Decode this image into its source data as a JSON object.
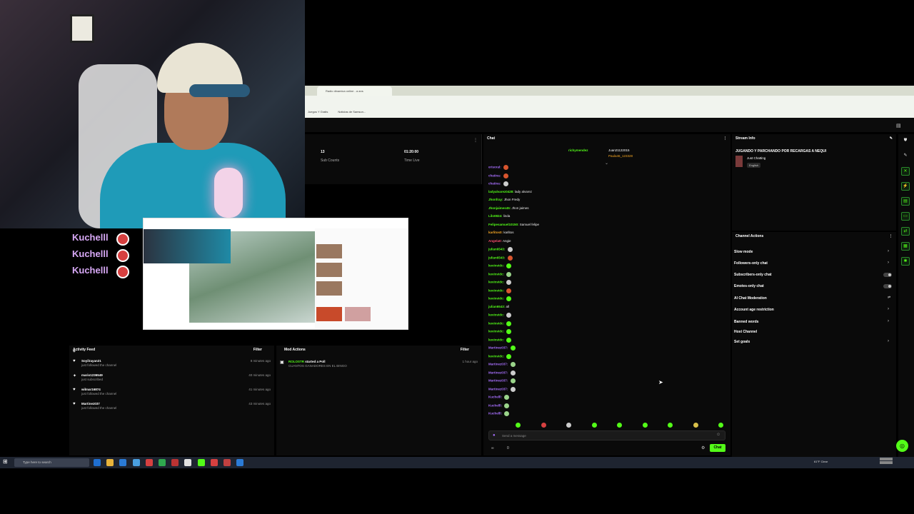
{
  "browser": {
    "tab_title": "Radio dinamica online - a ans",
    "bookmarks": [
      "Juegos Y Gratis",
      "Noticias de Samsun..."
    ]
  },
  "stats": [
    {
      "value": "13",
      "label": "Sub Counts"
    },
    {
      "value": "01:20:00",
      "label": "Time Live"
    }
  ],
  "overlay": {
    "names": [
      "Kuchelll",
      "Kuchelll",
      "Kuchelll"
    ]
  },
  "activity_feed": {
    "title": "Activity Feed",
    "filter_label": "Filter",
    "items": [
      {
        "user": "Soyilrayan21",
        "action": "just followed the channel",
        "time": "8 minutes ago",
        "icon": "heart-icon"
      },
      {
        "user": "mario1236549",
        "action": "just subscribed",
        "time": "40 minutes ago",
        "icon": "star-icon"
      },
      {
        "user": "wilmar16874",
        "action": "just followed the channel",
        "time": "41 minutes ago",
        "icon": "heart-icon"
      },
      {
        "user": "Martinez037",
        "action": "just followed the channel",
        "time": "43 minutes ago",
        "icon": "heart-icon"
      }
    ]
  },
  "mod_actions": {
    "title": "Mod Actions",
    "filter_label": "Filter",
    "items": [
      {
        "user": "ROLOSTR",
        "action": "started a Poll",
        "detail": "CUANTOS GANADORES EN EL BINGO",
        "time": "1 hour ago"
      }
    ]
  },
  "chat": {
    "title": "Chat",
    "pinned": [
      "richymendez",
      "Juan21122015",
      "Paula46_123328"
    ],
    "messages": [
      {
        "user": "erisoral:",
        "text": "",
        "color": "#a970ff",
        "emote": "#d8552e"
      },
      {
        "user": "chatina:",
        "text": "",
        "color": "#a970ff",
        "emote": "#d8552e"
      },
      {
        "user": "chatina:",
        "text": "",
        "color": "#a970ff",
        "emote": "#cccccc"
      },
      {
        "user": "ladyalvarez0428:",
        "text": "lady alvarez",
        "color": "#53fc18",
        "emote": ""
      },
      {
        "user": "Jhonfray:",
        "text": "Jhon Fredy",
        "color": "#53fc18",
        "emote": ""
      },
      {
        "user": "Jhonjaimes45:",
        "text": "Jhon jaimes",
        "color": "#53fc18",
        "emote": ""
      },
      {
        "user": "Lilo0824:",
        "text": "linda",
        "color": "#53fc18",
        "emote": ""
      },
      {
        "user": "Felipesamuel10150:",
        "text": "Samuel felipe",
        "color": "#53fc18",
        "emote": ""
      },
      {
        "user": "karlitos0:",
        "text": "karlitos",
        "color": "#f5a623",
        "emote": ""
      },
      {
        "user": "Angela0:",
        "text": "Angie",
        "color": "#ff4d6d",
        "emote": ""
      },
      {
        "user": "julian6543:",
        "text": "",
        "color": "#53fc18",
        "emote": "#cccccc"
      },
      {
        "user": "julian6543:",
        "text": "",
        "color": "#53fc18",
        "emote": "#d8552e"
      },
      {
        "user": "kevinvidc:",
        "text": "",
        "color": "#53fc18",
        "emote": "#53fc18"
      },
      {
        "user": "kevinvidc:",
        "text": "",
        "color": "#53fc18",
        "emote": "#9ad48a"
      },
      {
        "user": "kevinvidc:",
        "text": "",
        "color": "#53fc18",
        "emote": "#cccccc"
      },
      {
        "user": "kevinvidc:",
        "text": "",
        "color": "#53fc18",
        "emote": "#d8552e"
      },
      {
        "user": "kevinvidc:",
        "text": "",
        "color": "#53fc18",
        "emote": "#53fc18"
      },
      {
        "user": "julian6543:",
        "text": "all",
        "color": "#53fc18",
        "emote": ""
      },
      {
        "user": "kevinvidc:",
        "text": "",
        "color": "#53fc18",
        "emote": "#cccccc"
      },
      {
        "user": "kevinvidc:",
        "text": "",
        "color": "#53fc18",
        "emote": "#53fc18"
      },
      {
        "user": "kevinvidc:",
        "text": "",
        "color": "#53fc18",
        "emote": "#53fc18"
      },
      {
        "user": "kevinvidc:",
        "text": "",
        "color": "#53fc18",
        "emote": "#53fc18"
      },
      {
        "user": "Martinez037:",
        "text": "",
        "color": "#a970ff",
        "emote": "#53fc18"
      },
      {
        "user": "kevinvidc:",
        "text": "",
        "color": "#53fc18",
        "emote": "#53fc18"
      },
      {
        "user": "Martinez037:",
        "text": "",
        "color": "#a970ff",
        "emote": "#9ad48a"
      },
      {
        "user": "Martinez037:",
        "text": "",
        "color": "#a970ff",
        "emote": "#cccccc"
      },
      {
        "user": "Martinez037:",
        "text": "",
        "color": "#a970ff",
        "emote": "#9ad48a"
      },
      {
        "user": "Martinez037:",
        "text": "",
        "color": "#a970ff",
        "emote": "#cccccc"
      },
      {
        "user": "Kuchelll:",
        "text": "",
        "color": "#a970ff",
        "emote": "#9ad48a"
      },
      {
        "user": "Kuchelll:",
        "text": "",
        "color": "#a970ff",
        "emote": "#9ad48a"
      },
      {
        "user": "Kuchelll:",
        "text": "",
        "color": "#a970ff",
        "emote": "#9ad48a"
      }
    ],
    "input_placeholder": "Send a message",
    "counter_left": "∞",
    "counter_right": "0",
    "send_label": "Chat"
  },
  "stream_info": {
    "title": "Stream Info",
    "stream_title": "JUGANDO Y PARCHANDO POR RECARGAS A NEQUI",
    "category": "Just Chatting",
    "language": "English"
  },
  "channel_actions": {
    "title": "Channel Actions",
    "items": [
      {
        "label": "Slow mode",
        "control": "chevron"
      },
      {
        "label": "Followers-only chat",
        "control": "chevron"
      },
      {
        "label": "Subscribers-only chat",
        "control": "toggle"
      },
      {
        "label": "Emotes-only chat",
        "control": "toggle"
      },
      {
        "label": "AI Chat Moderation",
        "control": "settings"
      },
      {
        "label": "Account age restriction",
        "control": "chevron"
      },
      {
        "label": "Banned words",
        "control": "chevron"
      },
      {
        "label": "Host Channel",
        "control": "none"
      },
      {
        "label": "Set goals",
        "control": "chevron"
      }
    ]
  },
  "taskbar": {
    "search_placeholder": "Type here to search",
    "weather": "61°F Clear"
  },
  "colors": {
    "accent": "#53fc18",
    "username_purple": "#a970ff",
    "panel_bg": "#0a0a0a"
  }
}
